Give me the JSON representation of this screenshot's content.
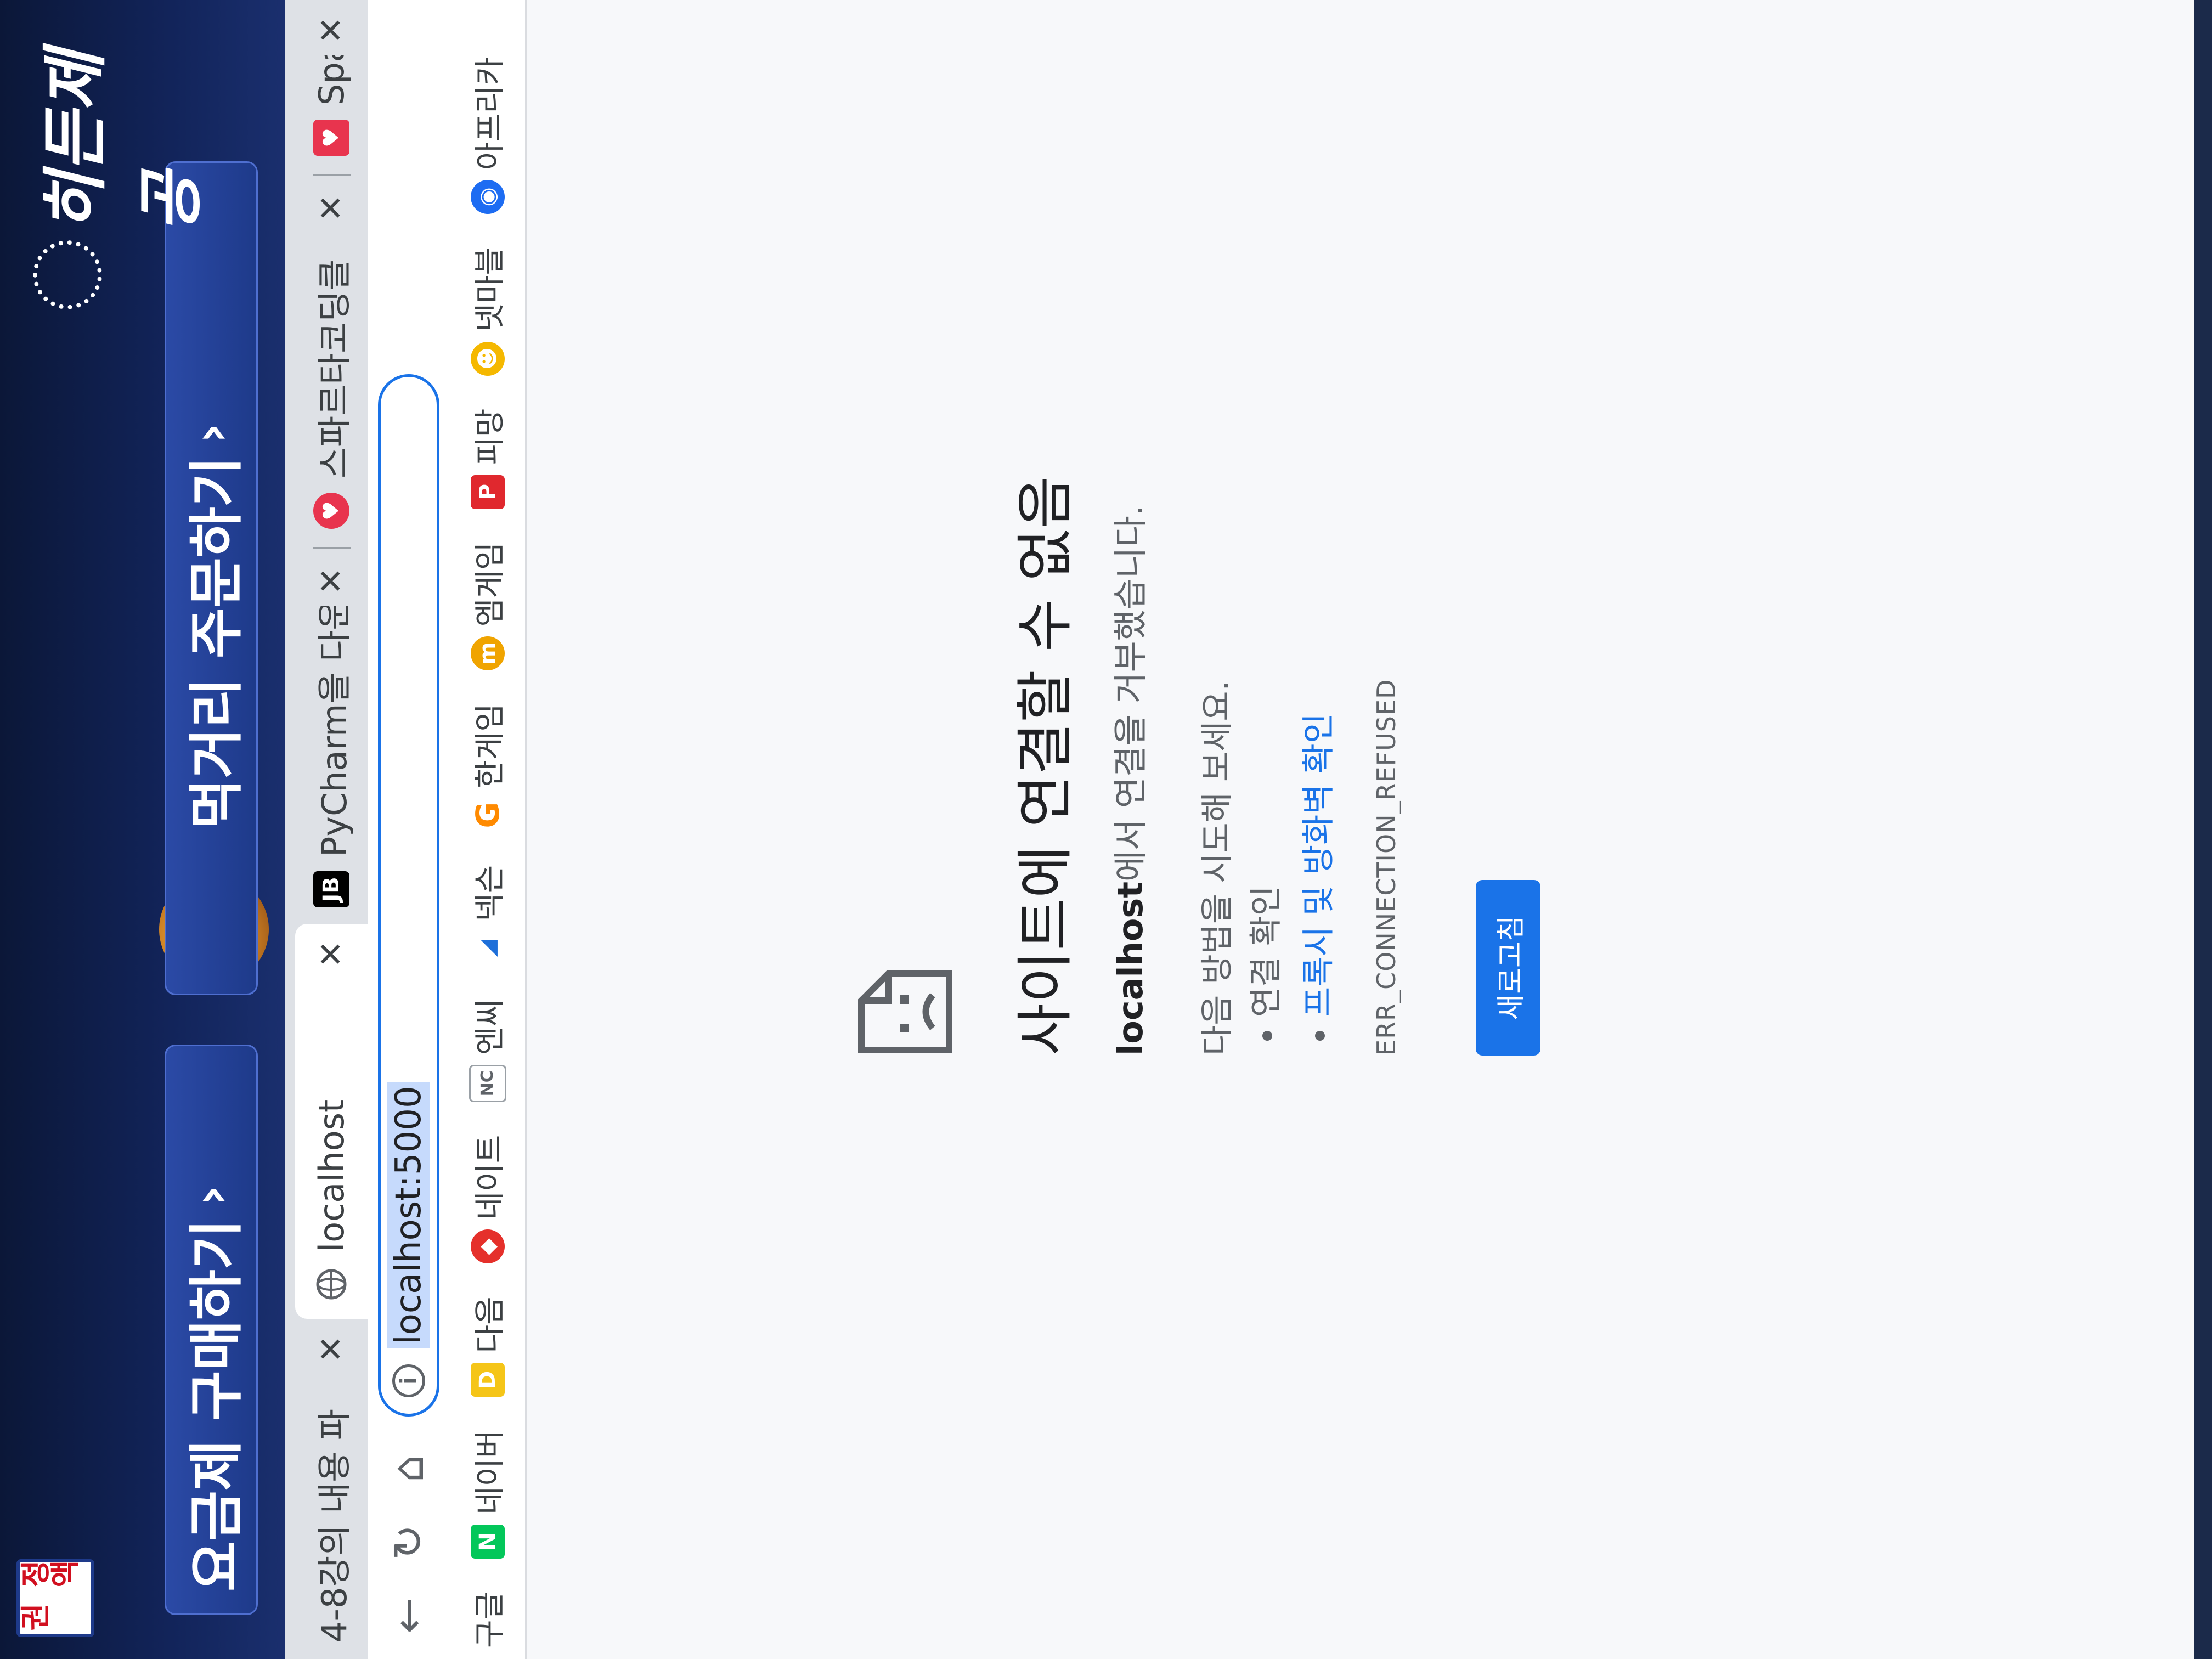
{
  "ad": {
    "brand_badge": "정액권",
    "plan_label": "요금제 구매하기",
    "order_label": "먹거리 주문하기",
    "logo": "히든제공",
    "chevron": "›"
  },
  "tabs": [
    {
      "title": "4-8강의 내용 파",
      "favicon": "",
      "close": "✕",
      "active": false
    },
    {
      "title": "localhost",
      "favicon": "globe",
      "close": "✕",
      "active": true
    },
    {
      "title": "PyCharm을 다운",
      "favicon": "JB",
      "close": "✕",
      "active": false
    },
    {
      "title": "스파르타코딩클",
      "favicon": "sparta",
      "close": "✕",
      "active": false
    },
    {
      "title": "SpartaCodingCl",
      "favicon": "sparta",
      "close": "✕",
      "active": false
    }
  ],
  "toolbar": {
    "back": "←",
    "reload": "↻",
    "home": "⌂",
    "info": "i",
    "url": "localhost:5000"
  },
  "bookmarks": [
    {
      "label": "구글",
      "icon": "",
      "color": "#ffffff"
    },
    {
      "label": "네이버",
      "icon": "N",
      "color": "#03c75a"
    },
    {
      "label": "다음",
      "icon": "D",
      "color": "#f5c518"
    },
    {
      "label": "네이트",
      "icon": "◆",
      "color": "#e5302b"
    },
    {
      "label": "엔씨",
      "icon": "NC",
      "color": "#9aa0a6"
    },
    {
      "label": "넥슨",
      "icon": "◢",
      "color": "#1e6fd9"
    },
    {
      "label": "한게임",
      "icon": "G",
      "color": "#ff8a00"
    },
    {
      "label": "엠게임",
      "icon": "m",
      "color": "#f0a400"
    },
    {
      "label": "피망",
      "icon": "P",
      "color": "#e0282e"
    },
    {
      "label": "넷마블",
      "icon": "☻",
      "color": "#f5b800"
    },
    {
      "label": "아프리카",
      "icon": "◉",
      "color": "#1d6cf2"
    }
  ],
  "error": {
    "title": "사이트에 연결할 수 없음",
    "host": "localhost",
    "desc_suffix": "에서 연결을 거부했습니다.",
    "suggest_heading": "다음 방법을 시도해 보세요.",
    "suggest_1": "연결 확인",
    "suggest_2": "프록시 및 방화벽 확인",
    "code": "ERR_CONNECTION_REFUSED",
    "reload_label": "새로고침"
  },
  "colors": {
    "accent": "#1a73e8",
    "ad_bg": "#12245a"
  }
}
